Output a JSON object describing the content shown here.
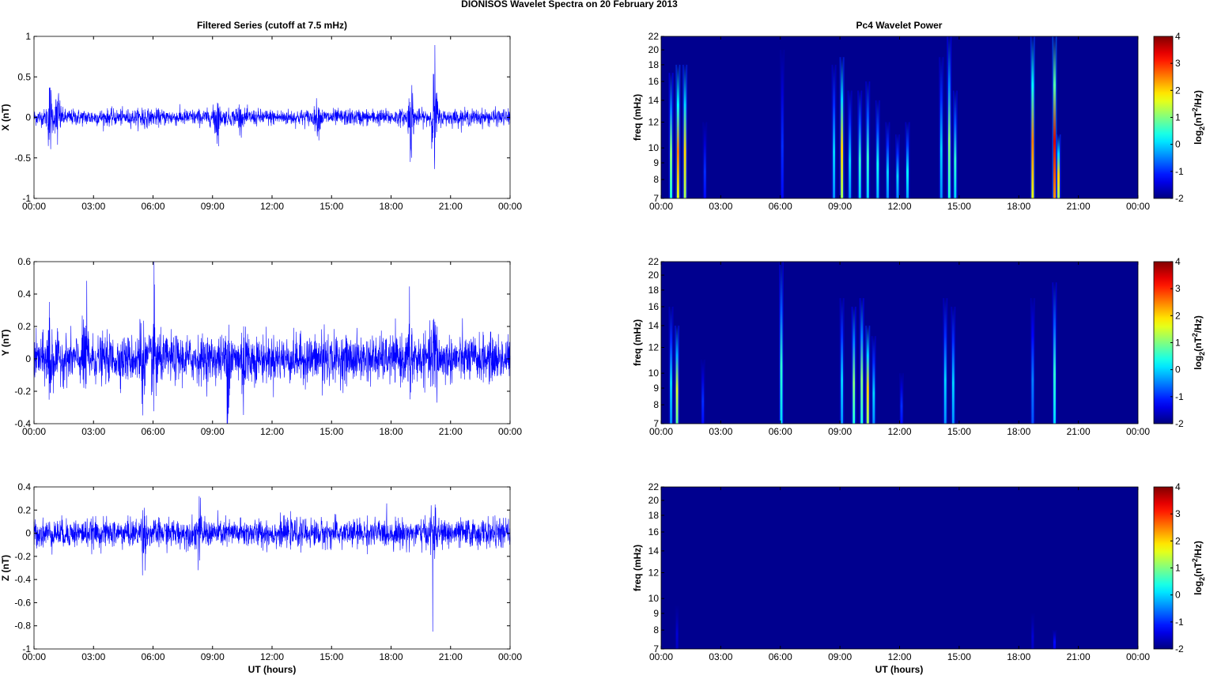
{
  "chart_data": {
    "type": "figure",
    "title": "DIONISOS Wavelet Spectra on 20 February  2013",
    "left_title": "Filtered Series (cutoff at 7.5 mHz)",
    "right_title": "Pc4 Wavelet Power",
    "xlabel": "UT (hours)",
    "xticks": [
      "00:00",
      "03:00",
      "06:00",
      "09:00",
      "12:00",
      "15:00",
      "18:00",
      "21:00",
      "00:00"
    ],
    "xlim_hours": [
      0,
      24
    ],
    "series": [
      {
        "name": "X",
        "ylabel": "X (nT)",
        "ylim": [
          -1,
          1
        ],
        "yticks": [
          "-1",
          "-0.5",
          "0",
          "0.5",
          "1"
        ],
        "ytick_values": [
          -1,
          -0.5,
          0,
          0.5,
          1
        ],
        "base_amplitude": 0.05,
        "bursts_hours_amplitude": [
          [
            0.8,
            0.4
          ],
          [
            1.2,
            0.35
          ],
          [
            5.5,
            0.1
          ],
          [
            9.2,
            0.3
          ],
          [
            10.3,
            0.12
          ],
          [
            14.3,
            0.15
          ],
          [
            19.0,
            0.45
          ],
          [
            20.2,
            0.7
          ]
        ]
      },
      {
        "name": "Y",
        "ylabel": "Y (nT)",
        "ylim": [
          -0.4,
          0.6
        ],
        "yticks": [
          "-0.4",
          "-0.2",
          "0",
          "0.2",
          "0.4",
          "0.6"
        ],
        "ytick_values": [
          -0.4,
          -0.2,
          0,
          0.2,
          0.4,
          0.6
        ],
        "base_amplitude": 0.07,
        "bursts_hours_amplitude": [
          [
            0.8,
            0.3
          ],
          [
            2.6,
            0.3
          ],
          [
            5.4,
            0.25
          ],
          [
            6.1,
            0.38
          ],
          [
            9.8,
            0.25
          ],
          [
            10.6,
            0.3
          ],
          [
            14.6,
            0.2
          ],
          [
            19.0,
            0.25
          ],
          [
            20.2,
            0.3
          ]
        ]
      },
      {
        "name": "Z",
        "ylabel": "Z (nT)",
        "ylim": [
          -1,
          0.4
        ],
        "yticks": [
          "-1",
          "-0.8",
          "-0.6",
          "-0.4",
          "-0.2",
          "0",
          "0.2",
          "0.4"
        ],
        "ytick_values": [
          -1,
          -0.8,
          -0.6,
          -0.4,
          -0.2,
          0,
          0.2,
          0.4
        ],
        "base_amplitude": 0.06,
        "bursts_hours_amplitude": [
          [
            5.5,
            0.2
          ],
          [
            8.3,
            0.2
          ],
          [
            20.1,
            0.2
          ]
        ],
        "spike": [
          20.1,
          -0.85
        ]
      }
    ],
    "wavelet": {
      "ylabel": "freq (mHz)",
      "ylim_mHz": [
        7,
        22
      ],
      "yticks": [
        "7",
        "8",
        "9",
        "10",
        "12",
        "14",
        "16",
        "18",
        "20",
        "22"
      ],
      "ytick_values": [
        7,
        8,
        9,
        10,
        12,
        14,
        16,
        18,
        20,
        22
      ],
      "colorbar_label": "log2(nT2/Hz)",
      "colorbar_label_parts": [
        "log",
        "2",
        "(nT",
        "2",
        "/Hz)"
      ],
      "clim": [
        -2,
        4
      ],
      "colorbar_ticks": [
        "-2",
        "-1",
        "0",
        "1",
        "2",
        "3",
        "4"
      ],
      "colorbar_tick_values": [
        -2,
        -1,
        0,
        1,
        2,
        3,
        4
      ],
      "events_hours_fmax_peak": [
        [
          [
            0.5,
            17,
            1
          ],
          [
            0.85,
            18,
            2.5
          ],
          [
            1.2,
            18,
            2
          ],
          [
            2.2,
            12,
            -1
          ],
          [
            6.1,
            20,
            -1
          ],
          [
            8.7,
            18,
            0
          ],
          [
            9.1,
            19,
            2
          ],
          [
            9.5,
            15,
            0
          ],
          [
            10.0,
            15,
            0.5
          ],
          [
            10.4,
            16,
            0.5
          ],
          [
            10.9,
            14,
            0.3
          ],
          [
            11.4,
            12,
            0
          ],
          [
            11.9,
            11,
            0
          ],
          [
            12.4,
            12,
            0.2
          ],
          [
            14.1,
            19,
            0
          ],
          [
            14.5,
            22,
            1
          ],
          [
            14.8,
            15,
            0.5
          ],
          [
            18.7,
            22,
            2.5
          ],
          [
            19.8,
            22,
            3.5
          ],
          [
            20.0,
            11,
            2
          ]
        ],
        [
          [
            0.5,
            16,
            0
          ],
          [
            0.8,
            14,
            1.5
          ],
          [
            2.1,
            11,
            -1
          ],
          [
            6.05,
            22,
            0.5
          ],
          [
            9.1,
            17,
            0
          ],
          [
            9.7,
            16,
            1
          ],
          [
            10.1,
            17,
            1
          ],
          [
            10.4,
            14,
            2
          ],
          [
            10.7,
            13,
            0
          ],
          [
            12.1,
            10,
            -1
          ],
          [
            14.3,
            17,
            0
          ],
          [
            14.7,
            16,
            0
          ],
          [
            18.7,
            17,
            -0.5
          ],
          [
            19.8,
            19,
            0.5
          ]
        ],
        [
          [
            0.8,
            9.5,
            -1.5
          ],
          [
            18.7,
            9,
            -1.5
          ],
          [
            19.8,
            8,
            -1.2
          ]
        ]
      ]
    },
    "colors": {
      "line": "#0000ff",
      "background": "#00008f"
    }
  }
}
